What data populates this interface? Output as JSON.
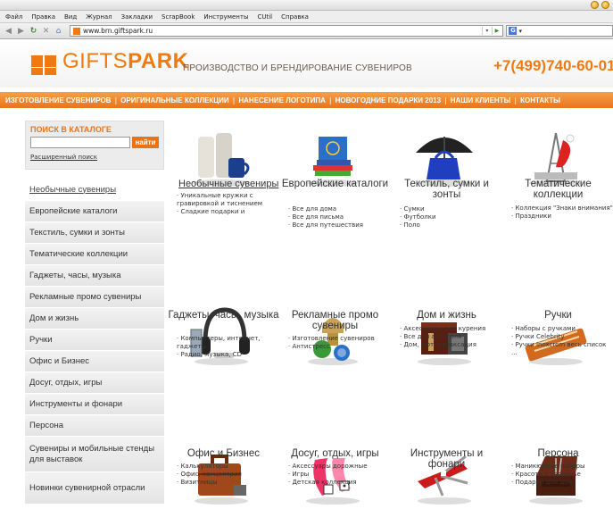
{
  "browser": {
    "menu": [
      "Файл",
      "Правка",
      "Вид",
      "Журнал",
      "Закладки",
      "ScrapBook",
      "Инструменты",
      "CUtil",
      "Справка"
    ],
    "url": "www.brn.giftspark.ru"
  },
  "header": {
    "logo_gifts": "GIFTS",
    "logo_park": "PARK",
    "tagline": "ПРОИЗВОДСТВО И БРЕНДИРОВАНИЕ СУВЕНИРОВ",
    "phone": "+7(499)740-60-01"
  },
  "topnav": [
    "ИЗГОТОВЛЕНИЕ СУВЕНИРОВ",
    "ОРИГИНАЛЬНЫЕ КОЛЛЕКЦИИ",
    "НАНЕСЕНИЕ ЛОГОТИПА",
    "НОВОГОДНИЕ ПОДАРКИ 2013",
    "НАШИ КЛИЕНТЫ",
    "КОНТАКТЫ"
  ],
  "search": {
    "title": "ПОИСК В КАТАЛОГЕ",
    "button": "найти",
    "advanced": "Расширенный поиск"
  },
  "sidebar": [
    {
      "label": "Необычные сувениры",
      "active": true
    },
    {
      "label": "Европейские каталоги"
    },
    {
      "label": "Текстиль, сумки и зонты"
    },
    {
      "label": "Тематические коллекции"
    },
    {
      "label": "Гаджеты, часы, музыка"
    },
    {
      "label": "Рекламные промо сувениры"
    },
    {
      "label": "Дом и жизнь"
    },
    {
      "label": "Ручки"
    },
    {
      "label": "Офис и Бизнес"
    },
    {
      "label": "Досуг, отдых, игры"
    },
    {
      "label": "Инструменты и фонари"
    },
    {
      "label": "Персона"
    },
    {
      "label": "Сувениры и мобильные стенды для выставок"
    },
    {
      "label": "Новинки сувенирной отрасли"
    }
  ],
  "products": [
    {
      "title": "Необычные сувениры",
      "link": true,
      "items": [
        "Уникальные кружки с гравировкой и тиснением",
        "Сладкие подарки и"
      ]
    },
    {
      "title": "Европейские каталоги",
      "items": [
        "Все для дома",
        "Все для письма",
        "Все для путешествия"
      ]
    },
    {
      "title": "Текстиль, сумки и зонты",
      "items": [
        "Сумки",
        "Футболки",
        "Поло"
      ]
    },
    {
      "title": "Тематические коллекции",
      "items": [
        "Коллекция \"Знаки внимания\"",
        "Праздники"
      ]
    },
    {
      "title": "Гаджеты, часы, музыка",
      "items": [
        "Компьютеры, интернет, гаджеты",
        "Радио, музыка, CD"
      ]
    },
    {
      "title": "Рекламные промо сувениры",
      "items": [
        "Изготовление сувениров",
        "Антистресс"
      ]
    },
    {
      "title": "Дом и жизнь",
      "items": [
        "Аксессуары для курения",
        "Все для алкоголя",
        "Дом, уют, релаксация"
      ]
    },
    {
      "title": "Ручки",
      "items": [
        "Наборы с ручками",
        "Ручки Celebrity",
        "Ручки Inoxcrom весь список ..."
      ]
    },
    {
      "title": "Офис и Бизнес",
      "items": [
        "Калькуляторы",
        "Офис, канцелярия",
        "Визитницы"
      ]
    },
    {
      "title": "Досуг, отдых, игры",
      "items": [
        "Аксессуары дорожные",
        "Игры",
        "Детская коллекция"
      ]
    },
    {
      "title": "Инструменты и фонари",
      "items": []
    },
    {
      "title": "Персона",
      "items": [
        "Маникюрные наборы",
        "Красота и здоровье",
        "Подарки для дам"
      ]
    }
  ]
}
